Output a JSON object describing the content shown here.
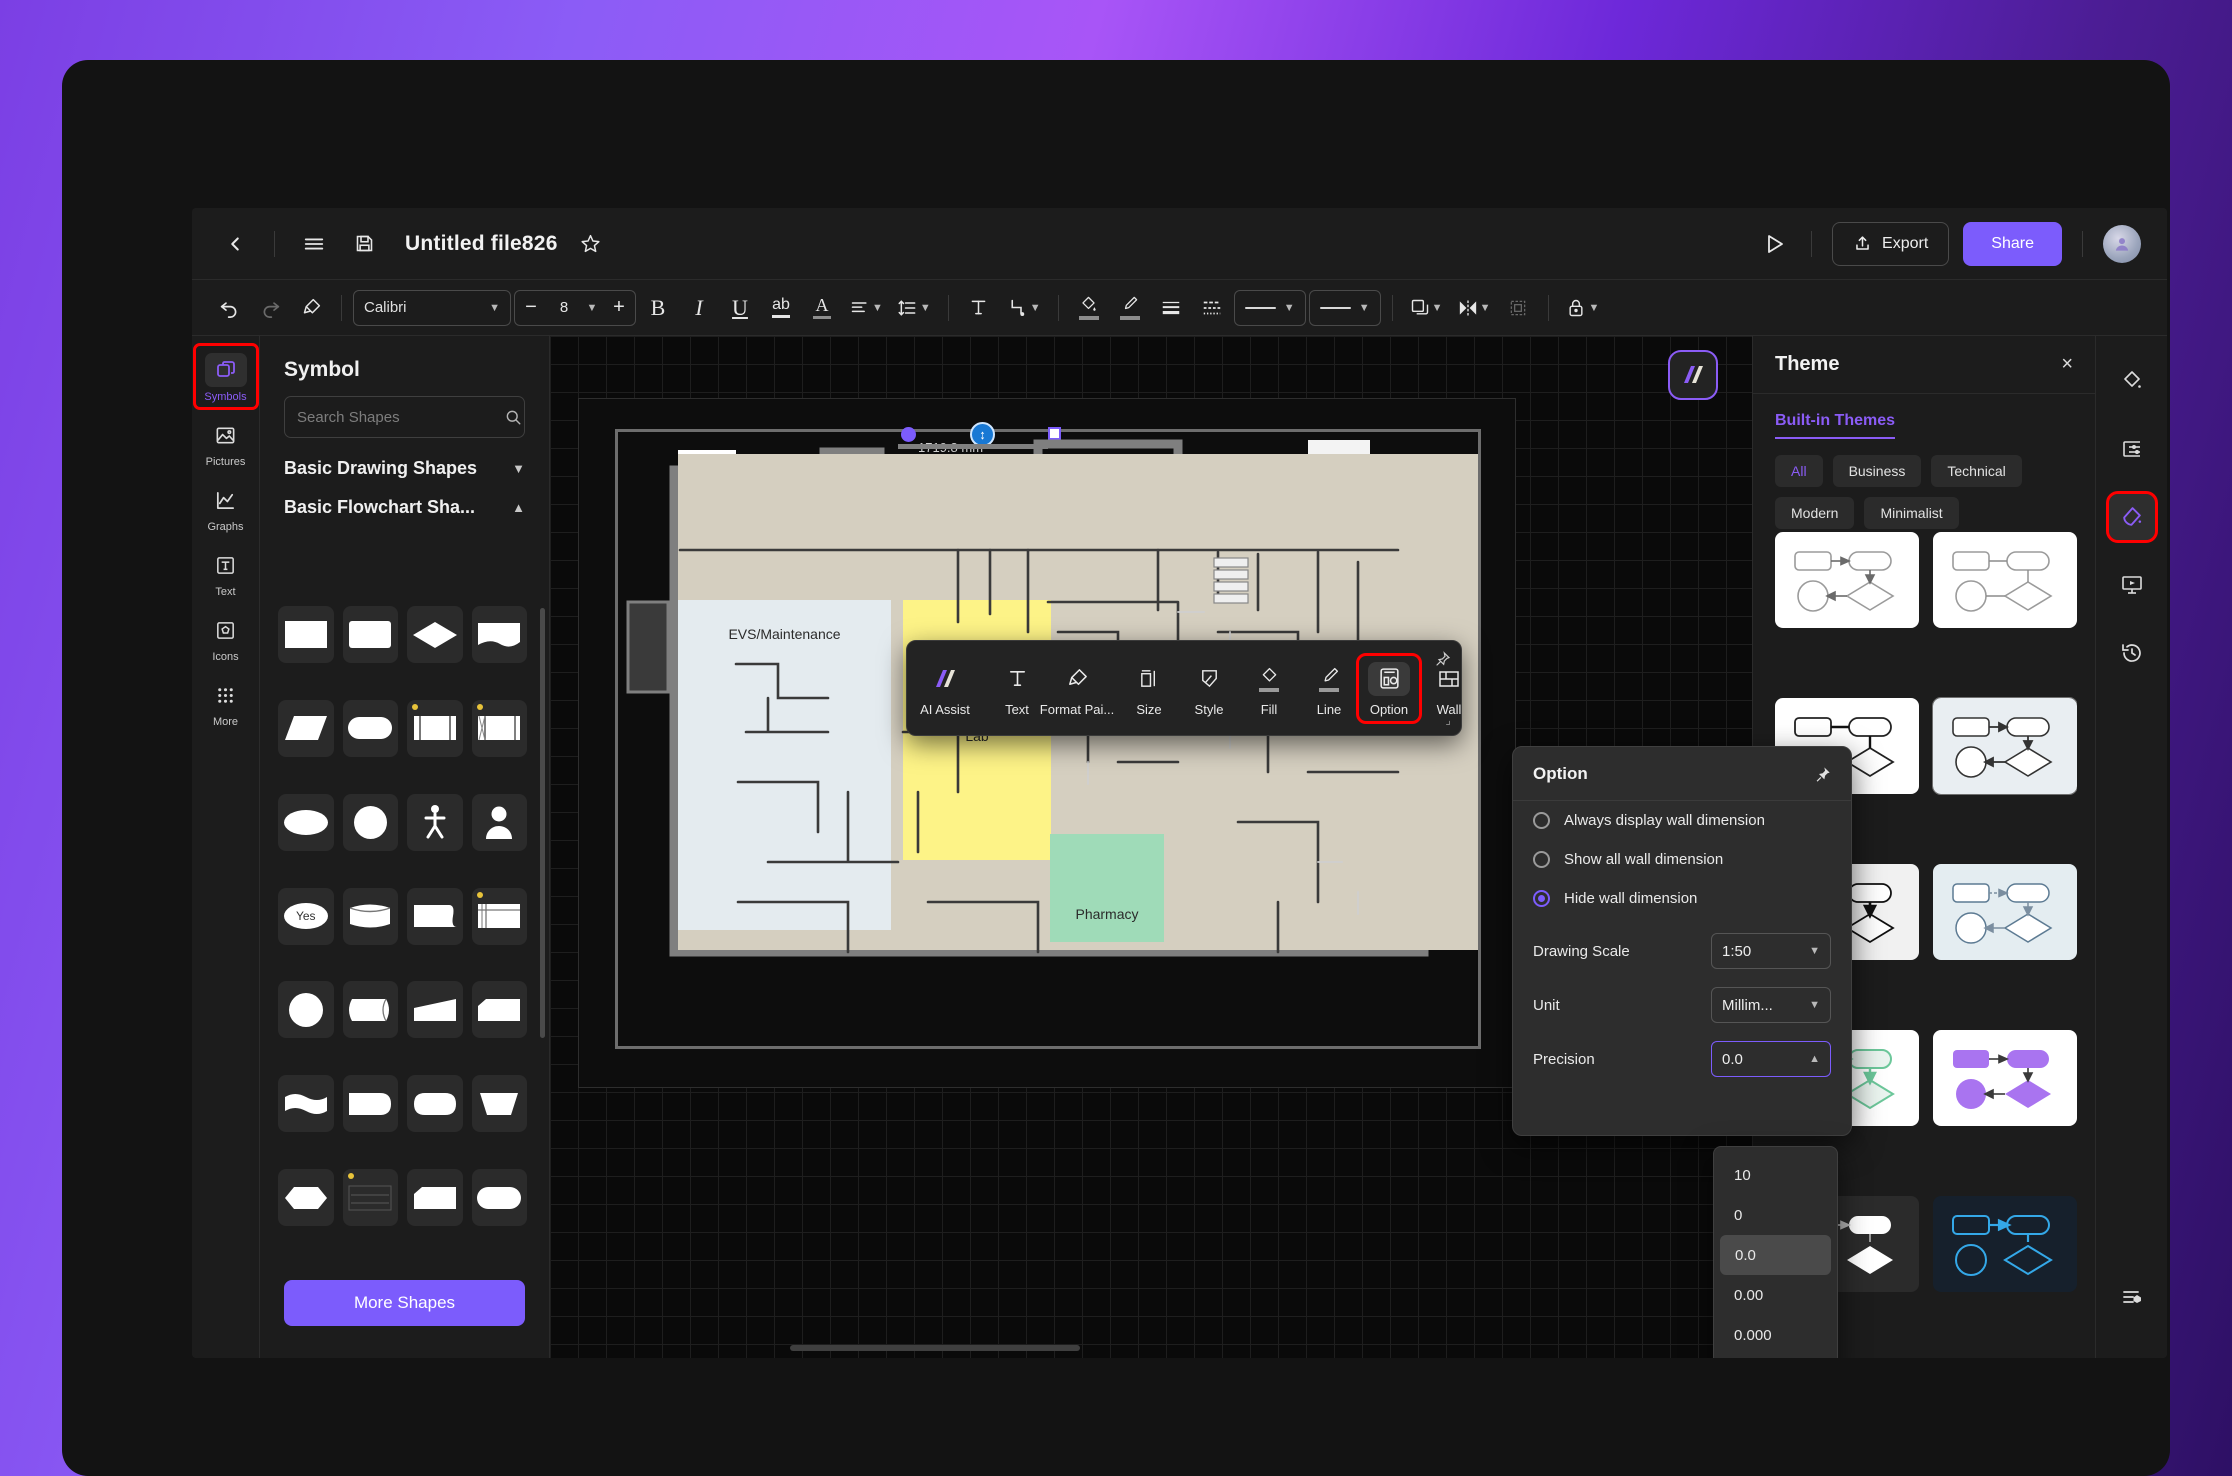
{
  "header": {
    "back_icon": "chevron-left-icon",
    "menu_icon": "hamburger-menu-icon",
    "save_icon": "save-icon",
    "title": "Untitled file826",
    "favorite_icon": "star-icon",
    "present_icon": "play-icon",
    "export_label": "Export",
    "share_label": "Share"
  },
  "toolbar": {
    "undo_icon": "undo-icon",
    "redo_icon": "redo-icon",
    "format_painter_icon": "format-painter-icon",
    "font_family": "Calibri",
    "font_size": "8",
    "bold": "B",
    "italic": "I",
    "underline": "U",
    "strikethrough": "ab",
    "font_color": "A",
    "align_icon": "align-left-icon",
    "line_spacing_icon": "line-spacing-icon",
    "text_icon": "text-box-icon",
    "connector_icon": "connector-icon",
    "fill_icon": "fill-bucket-icon",
    "pen_icon": "brush-icon",
    "line_weight_icon": "line-weight-icon",
    "line_dash_icon": "line-dash-icon",
    "line_style_1": "solid-line",
    "line_style_2": "solid-line",
    "arrange_icon": "arrange-layers-icon",
    "flip_icon": "flip-icon",
    "group_icon": "group-icon",
    "lock_icon": "lock-icon"
  },
  "left_rail": {
    "items": [
      {
        "label": "Symbols",
        "icon": "symbols-icon",
        "active": true
      },
      {
        "label": "Pictures",
        "icon": "picture-icon",
        "active": false
      },
      {
        "label": "Graphs",
        "icon": "graph-icon",
        "active": false
      },
      {
        "label": "Text",
        "icon": "text-icon",
        "active": false
      },
      {
        "label": "Icons",
        "icon": "icons-icon",
        "active": false
      },
      {
        "label": "More",
        "icon": "more-dots-icon",
        "active": false
      }
    ]
  },
  "symbol_panel": {
    "title": "Symbol",
    "search_placeholder": "Search Shapes",
    "search_value": "",
    "search_icon": "search-icon",
    "sections": [
      {
        "label": "Basic Drawing Shapes",
        "expanded": false
      },
      {
        "label": "Basic Flowchart Sha...",
        "expanded": true
      }
    ],
    "shape_cells": [
      {
        "shape": "rectangle",
        "badge": false
      },
      {
        "shape": "rounded-rectangle",
        "badge": false
      },
      {
        "shape": "diamond",
        "badge": false
      },
      {
        "shape": "wave-document",
        "badge": false
      },
      {
        "shape": "parallelogram",
        "badge": false
      },
      {
        "shape": "pill",
        "badge": false
      },
      {
        "shape": "predefined-process",
        "badge": true
      },
      {
        "shape": "internal-storage",
        "badge": true
      },
      {
        "shape": "ellipse",
        "badge": false
      },
      {
        "shape": "circle",
        "badge": false
      },
      {
        "shape": "actor-stick",
        "badge": false
      },
      {
        "shape": "person",
        "badge": false
      },
      {
        "shape": "yes-ellipse",
        "badge": false,
        "text": "Yes"
      },
      {
        "shape": "cylinder",
        "badge": false
      },
      {
        "shape": "document-curve",
        "badge": false
      },
      {
        "shape": "table-grid",
        "badge": true
      },
      {
        "shape": "circle-2",
        "badge": false
      },
      {
        "shape": "direct-access",
        "badge": false
      },
      {
        "shape": "tilted-slab",
        "badge": false
      },
      {
        "shape": "cut-corner",
        "badge": false
      },
      {
        "shape": "multi-wave",
        "badge": false
      },
      {
        "shape": "rounded-right",
        "badge": false
      },
      {
        "shape": "delay",
        "badge": false
      },
      {
        "shape": "trapezoid",
        "badge": false
      },
      {
        "shape": "hexagon",
        "badge": false
      },
      {
        "shape": "list-card",
        "badge": true
      },
      {
        "shape": "card",
        "badge": false
      },
      {
        "shape": "stadium",
        "badge": false
      }
    ],
    "more_shapes_label": "More Shapes"
  },
  "canvas": {
    "dimension_label": "1719.8 mm",
    "ai_fab_icon": "ai-logo-icon",
    "rooms": [
      {
        "name": "EVS/Maintenance",
        "color": "#e4ebef"
      },
      {
        "name": "Lab",
        "color": "#fdf387"
      },
      {
        "name": "Pharmacy",
        "color": "#9fdbb8"
      }
    ]
  },
  "float_toolbar": {
    "items": [
      {
        "label": "AI Assist",
        "icon": "ai-logo-icon",
        "active": false
      },
      {
        "label": "Text",
        "icon": "text-icon",
        "active": false
      },
      {
        "label": "Format Pai...",
        "icon": "format-painter-icon",
        "active": false
      },
      {
        "label": "Size",
        "icon": "size-icon",
        "active": false
      },
      {
        "label": "Style",
        "icon": "style-icon",
        "active": false
      },
      {
        "label": "Fill",
        "icon": "fill-bucket-icon",
        "active": false
      },
      {
        "label": "Line",
        "icon": "brush-icon",
        "active": false
      },
      {
        "label": "Option",
        "icon": "option-icon",
        "active": true
      },
      {
        "label": "Wall",
        "icon": "wall-icon",
        "active": false
      }
    ],
    "pin_icon": "pin-icon"
  },
  "option_popover": {
    "title": "Option",
    "pin_icon": "pin-icon",
    "radios": [
      {
        "label": "Always display wall dimension",
        "selected": false
      },
      {
        "label": "Show all wall dimension",
        "selected": false
      },
      {
        "label": "Hide wall dimension",
        "selected": true
      }
    ],
    "fields": [
      {
        "label": "Drawing Scale",
        "value": "1:50",
        "caret": "down"
      },
      {
        "label": "Unit",
        "value": "Millim...",
        "caret": "down"
      },
      {
        "label": "Precision",
        "value": "0.0",
        "caret": "up"
      }
    ],
    "precision_options": [
      {
        "label": "10",
        "selected": false
      },
      {
        "label": "0",
        "selected": false
      },
      {
        "label": "0.0",
        "selected": true
      },
      {
        "label": "0.00",
        "selected": false
      },
      {
        "label": "0.000",
        "selected": false
      }
    ]
  },
  "theme_panel": {
    "title": "Theme",
    "close_icon": "close-icon",
    "tab": "Built-in Themes",
    "chips": [
      {
        "label": "All",
        "active": true
      },
      {
        "label": "Business",
        "active": false
      },
      {
        "label": "Technical",
        "active": false
      },
      {
        "label": "Modern",
        "active": false
      },
      {
        "label": "Minimalist",
        "active": false
      }
    ],
    "cards": [
      {
        "style": "outline-thin",
        "bg": "white",
        "shape_color": "#ffffff",
        "stroke": "#8d8d8d"
      },
      {
        "style": "outline-plain",
        "bg": "white",
        "shape_color": "#ffffff",
        "stroke": "#8d8d8d"
      },
      {
        "style": "outline-bold",
        "bg": "white",
        "shape_color": "#ffffff",
        "stroke": "#222222"
      },
      {
        "style": "outline-arrow",
        "bg": "selected",
        "shape_color": "#ffffff",
        "stroke": "#333333"
      },
      {
        "style": "grey-bg",
        "bg": "grey",
        "shape_color": "#ffffff",
        "stroke": "#111111"
      },
      {
        "style": "blue-bg",
        "bg": "blue",
        "shape_color": "#ffffff",
        "stroke": "#4f6b84"
      },
      {
        "style": "green",
        "bg": "white",
        "shape_color": "#e8f2ef",
        "stroke": "#6cc79a"
      },
      {
        "style": "purple",
        "bg": "white",
        "shape_color": "#a974f0",
        "stroke": "#a974f0"
      },
      {
        "style": "dark-white",
        "bg": "dark",
        "shape_color": "#ffffff",
        "stroke": "#ffffff"
      },
      {
        "style": "navy-blue",
        "bg": "navy",
        "shape_color": "#16202c",
        "stroke": "#34a8e8"
      }
    ]
  },
  "right_rail": {
    "items": [
      {
        "icon": "fill-color-icon",
        "active": false
      },
      {
        "icon": "page-settings-icon",
        "active": false
      },
      {
        "icon": "theme-icon",
        "active": true
      },
      {
        "icon": "presentation-icon",
        "active": false
      },
      {
        "icon": "history-icon",
        "active": false
      }
    ],
    "bottom_item": {
      "icon": "list-settings-icon",
      "active": false
    }
  },
  "colors": {
    "accent": "#7c5cfc",
    "highlight": "#ff0000",
    "panel_bg": "#1c1c1c",
    "canvas_bg": "#0a0a0a"
  }
}
